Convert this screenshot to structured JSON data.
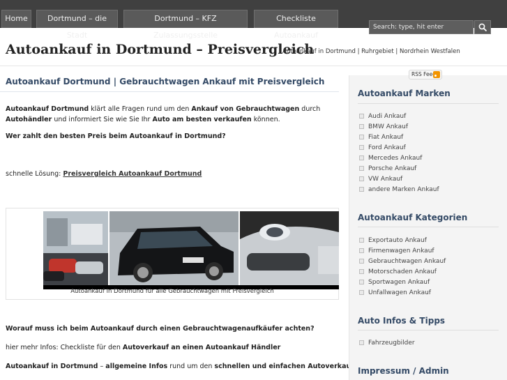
{
  "nav": {
    "items": [
      "Home",
      "Dortmund – die Stadt",
      "Dortmund – KFZ Zulassungsstelle",
      "Checkliste Autoankauf"
    ],
    "search_placeholder": "Search: type, hit enter"
  },
  "header": {
    "title": "Autoankauf in Dortmund – Preisvergleich",
    "description": "Autoankauf in Dortmund | Ruhrgebiet | Nordrhein Westfalen"
  },
  "post": {
    "title": "Autoankauf Dortmund | Gebrauchtwagen Ankauf mit Preisvergleich",
    "p1": {
      "b1": "Autoankauf Dortmund",
      "t1": " klärt alle Fragen rund um den ",
      "b2": "Ankauf von Gebrauchtwagen",
      "t2": " durch ",
      "b3": "Autohändler",
      "t3": " und informiert Sie wie Sie Ihr ",
      "b4": "Auto am besten verkaufen",
      "t4": " können."
    },
    "p2": "Wer zahlt den besten Preis beim Autoankauf in Dortmund?",
    "p3_text": "schnelle Lösung: ",
    "p3_link": "Preisvergleich Autoankauf Dortmund",
    "image_caption": "Autoankauf in Dortmund für alle Gebrauchtwagen mit Preisvergleich",
    "p4": "Worauf muss ich beim Autoankauf durch einen Gebrauchtwagenaufkäufer achten?",
    "p5_text": "hier mehr Infos: Checkliste für den ",
    "p5_bold": "Autoverkauf an einen Autoankauf Händler",
    "p6": {
      "b1": "Autoankauf in Dortmund",
      "t1": " – ",
      "b2": "allgemeine Infos",
      "t2": " rund um den ",
      "b3": "schnellen und einfachen Autoverkauf"
    }
  },
  "sidebar": {
    "rss_label": "RSS Feed",
    "widgets": [
      {
        "title": "Autoankauf Marken",
        "items": [
          "Audi Ankauf",
          "BMW Ankauf",
          "Fiat Ankauf",
          "Ford Ankauf",
          "Mercedes Ankauf",
          "Porsche Ankauf",
          "VW Ankauf",
          "andere Marken Ankauf"
        ]
      },
      {
        "title": "Autoankauf Kategorien",
        "items": [
          "Exportauto Ankauf",
          "Firmenwagen Ankauf",
          "Gebrauchtwagen Ankauf",
          "Motorschaden Ankauf",
          "Sportwagen Ankauf",
          "Unfallwagen Ankauf"
        ]
      },
      {
        "title": "Auto Infos & Tipps",
        "items": [
          "Fahrzeugbilder"
        ]
      },
      {
        "title": "Impressum / Admin",
        "items": []
      }
    ]
  }
}
